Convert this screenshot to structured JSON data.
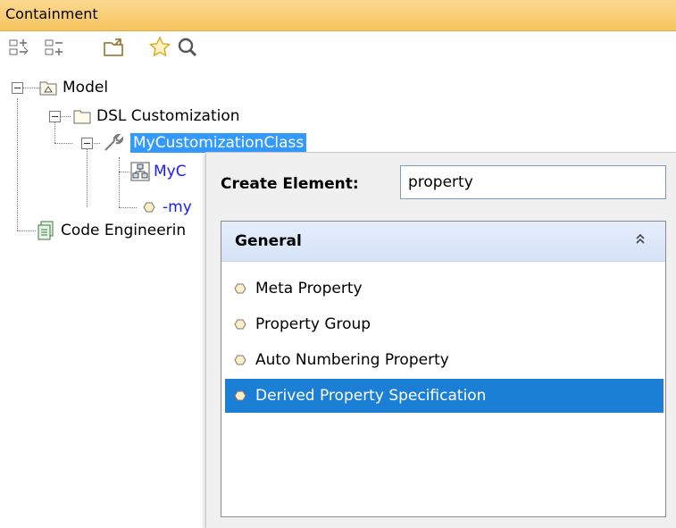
{
  "panel": {
    "title": "Containment",
    "toolbar": [
      {
        "icon": "collapse-all-icon"
      },
      {
        "icon": "expand-all-icon"
      },
      {
        "icon": "open-folder-icon"
      },
      {
        "icon": "favorite-star-icon"
      },
      {
        "icon": "search-icon"
      }
    ]
  },
  "tree": [
    {
      "label": "Model",
      "icon": "model-package-icon",
      "expanded": true
    },
    {
      "label": "DSL Customization",
      "icon": "folder-icon",
      "expanded": true
    },
    {
      "label": "MyCustomizationClass",
      "icon": "wrench-icon",
      "expanded": true,
      "selected": true
    },
    {
      "label": "MyC",
      "icon": "diagram-icon"
    },
    {
      "label": "-my",
      "icon": "property-icon"
    },
    {
      "label": "Code Engineerin",
      "icon": "code-engineering-icon"
    }
  ],
  "popup": {
    "create_label": "Create Element:",
    "search_value": "property",
    "group": {
      "label": "General",
      "collapse_glyph": "⌃"
    },
    "items": [
      {
        "label": "Meta Property",
        "icon": "property-icon"
      },
      {
        "label": "Property Group",
        "icon": "property-icon"
      },
      {
        "label": "Auto Numbering Property",
        "icon": "property-icon"
      },
      {
        "label": "Derived Property Specification",
        "icon": "property-icon",
        "highlighted": true
      }
    ]
  },
  "colors": {
    "titlebar": "#f6c45e",
    "selection": "#3399ff",
    "highlight": "#1c7fd6",
    "group_header": "#d5e2f6"
  }
}
